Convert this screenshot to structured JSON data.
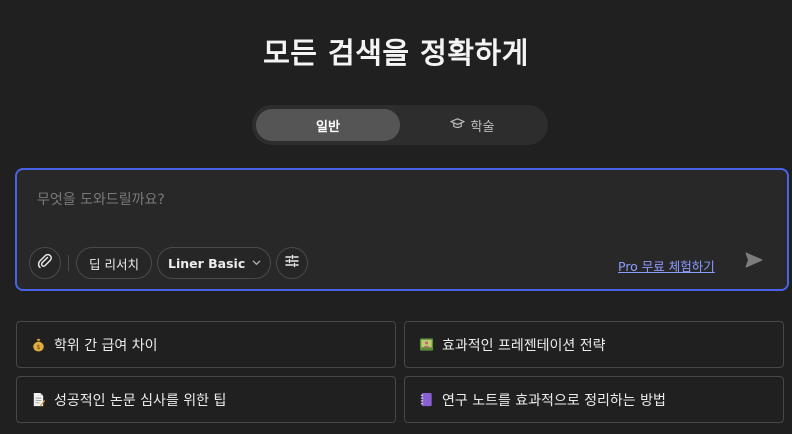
{
  "title": "모든 검색을 정확하게",
  "mode_tabs": [
    {
      "label": "일반",
      "active": true
    },
    {
      "label": "학술",
      "active": false,
      "icon": "graduation-cap-icon"
    }
  ],
  "search": {
    "placeholder": "무엇을 도와드릴까요?",
    "value": ""
  },
  "toolbar": {
    "attach_icon": "paperclip-icon",
    "deep_research_label": "딥 리서치",
    "model_label": "Liner Basic",
    "settings_icon": "sliders-icon",
    "pro_trial_label": "Pro 무료 체험하기",
    "send_icon": "send-icon"
  },
  "suggestions": [
    {
      "label": "학위 간 급여 차이",
      "icon": "money-bag-icon"
    },
    {
      "label": "효과적인 프레젠테이션 전략",
      "icon": "presentation-icon"
    },
    {
      "label": "성공적인 논문 심사를 위한 팁",
      "icon": "document-icon"
    },
    {
      "label": "연구 노트를 효과적으로 정리하는 방법",
      "icon": "notebook-icon"
    }
  ],
  "colors": {
    "background": "#202020",
    "accent_border": "#4a63e6",
    "link": "#8b9cff"
  }
}
